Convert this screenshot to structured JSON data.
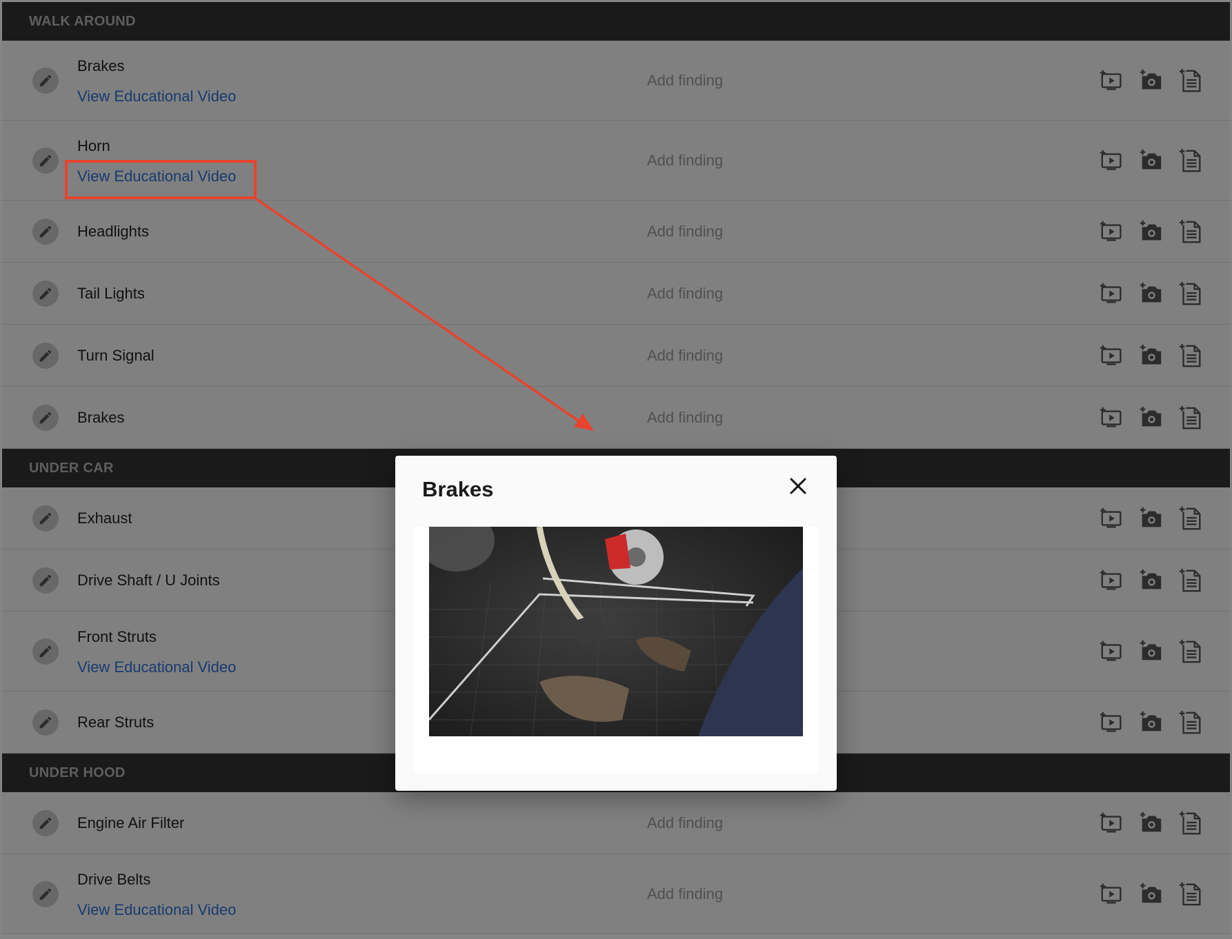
{
  "sections": [
    {
      "title": "WALK AROUND",
      "rows": [
        {
          "label": "Brakes",
          "link": "View Educational Video",
          "finding": "Add finding"
        },
        {
          "label": "Horn",
          "link": "View Educational Video",
          "finding": "Add finding"
        },
        {
          "label": "Headlights",
          "finding": "Add finding"
        },
        {
          "label": "Tail Lights",
          "finding": "Add finding"
        },
        {
          "label": "Turn Signal",
          "finding": "Add finding"
        },
        {
          "label": "Brakes",
          "finding": "Add finding"
        }
      ]
    },
    {
      "title": "UNDER CAR",
      "rows": [
        {
          "label": "Exhaust"
        },
        {
          "label": "Drive Shaft / U Joints"
        },
        {
          "label": "Front Struts",
          "link": "View Educational Video"
        },
        {
          "label": "Rear Struts"
        }
      ]
    },
    {
      "title": "UNDER HOOD",
      "rows": [
        {
          "label": "Engine Air Filter",
          "finding": "Add finding"
        },
        {
          "label": "Drive Belts",
          "link": "View Educational Video",
          "finding": "Add finding"
        }
      ]
    }
  ],
  "modal": {
    "title": "Brakes",
    "close_icon": "close-icon",
    "video": "brake-pedal-animation"
  },
  "icons": {
    "edit": "pencil-icon",
    "actions": [
      "add-video-icon",
      "add-photo-icon",
      "add-note-icon"
    ]
  },
  "colors": {
    "section_header_bg": "#333333",
    "link": "#2f6fd6",
    "highlight": "#e8432c",
    "row_bg": "#f6f6f6"
  }
}
